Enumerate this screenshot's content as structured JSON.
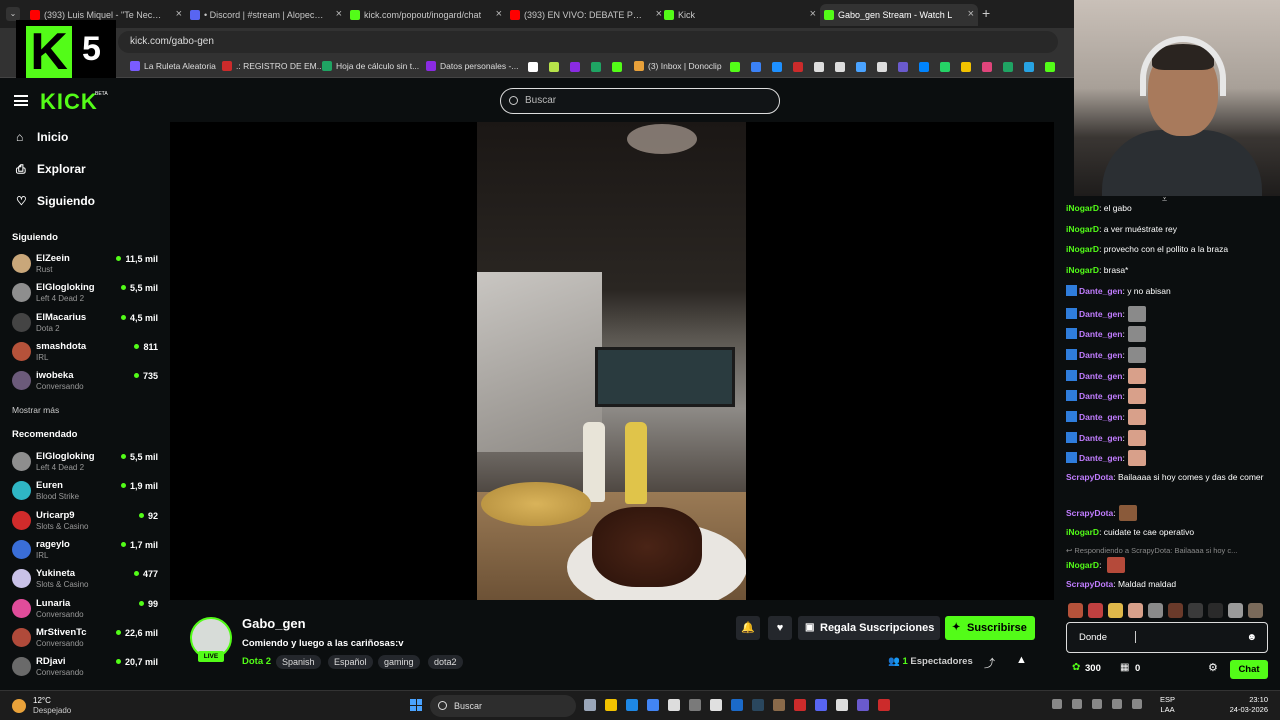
{
  "browser": {
    "tabs": [
      {
        "title": "(393) Luis Miquel - \"Te Necesito\"",
        "color": "#ff0000"
      },
      {
        "title": "• Discord | #stream | Alopecia A",
        "color": "#5865f2"
      },
      {
        "title": "kick.com/popout/inogard/chat",
        "color": "#53fc18"
      },
      {
        "title": "(393) EN VIVO: DEBATE PRESID",
        "color": "#ff0000"
      },
      {
        "title": "Kick",
        "color": "#53fc18"
      },
      {
        "title": "Gabo_gen Stream - Watch L",
        "color": "#53fc18"
      }
    ],
    "new_tab": "+",
    "url": "kick.com/gabo-gen",
    "bookmarks": [
      {
        "label": "La Ruleta Aleatoria",
        "color": "#7a5cff"
      },
      {
        "label": ".: REGISTRO DE EM...",
        "color": "#cc2b2b"
      },
      {
        "label": "Hoja de cálculo sin t...",
        "color": "#1fa463"
      },
      {
        "label": "Datos personales -...",
        "color": "#8a2be2"
      },
      {
        "label": "(3) Inbox | Donoclip",
        "color": "#e8a13a"
      }
    ]
  },
  "overlay_logo": {
    "letter": "K",
    "number": "5"
  },
  "kick": {
    "logo": "KICK",
    "beta": "BETA",
    "search_placeholder": "Buscar",
    "nav": [
      {
        "label": "Inicio",
        "icon": "home-icon",
        "glyph": "⌂"
      },
      {
        "label": "Explorar",
        "icon": "compass-icon",
        "glyph": "⎙"
      },
      {
        "label": "Siguiendo",
        "icon": "heart-icon",
        "glyph": "♡"
      }
    ],
    "following_title": "Siguiendo",
    "following": [
      {
        "name": "ElZeein",
        "category": "Rust",
        "viewers": "11,5 mil",
        "color": "#c9a77a"
      },
      {
        "name": "ElGlogloking",
        "category": "Left 4 Dead 2",
        "viewers": "5,5 mil",
        "color": "#8e8e8e"
      },
      {
        "name": "ElMacarius",
        "category": "Dota 2",
        "viewers": "4,5 mil",
        "color": "#444"
      },
      {
        "name": "smashdota",
        "category": "IRL",
        "viewers": "811",
        "color": "#b5523a"
      },
      {
        "name": "iwobeka",
        "category": "Conversando",
        "viewers": "735",
        "color": "#6b5a7a"
      }
    ],
    "show_more": "Mostrar más",
    "recommended_title": "Recomendado",
    "recommended": [
      {
        "name": "ElGlogloking",
        "category": "Left 4 Dead 2",
        "viewers": "5,5 mil",
        "color": "#8e8e8e"
      },
      {
        "name": "Euren",
        "category": "Blood Strike",
        "viewers": "1,9 mil",
        "color": "#2fb6c4"
      },
      {
        "name": "Uricarp9",
        "category": "Slots & Casino",
        "viewers": "92",
        "color": "#d12b2b"
      },
      {
        "name": "rageylo",
        "category": "IRL",
        "viewers": "1,7 mil",
        "color": "#3a6ed8"
      },
      {
        "name": "Yukineta",
        "category": "Slots & Casino",
        "viewers": "477",
        "color": "#c9c1e8"
      },
      {
        "name": "Lunaria",
        "category": "Conversando",
        "viewers": "99",
        "color": "#e04c9a"
      },
      {
        "name": "MrStivenTc",
        "category": "Conversando",
        "viewers": "22,6 mil",
        "color": "#b04a3a"
      },
      {
        "name": "RDjavi",
        "category": "Conversando",
        "viewers": "20,7 mil",
        "color": "#6a6a6a"
      }
    ]
  },
  "stream": {
    "streamer": "Gabo_gen",
    "live": "LIVE",
    "title": "Comiendo y luego a las cariñosas:v",
    "category": "Dota 2",
    "tags": [
      "Spanish",
      "Español",
      "gaming",
      "dota2"
    ],
    "gift_label": "Regala Suscripciones",
    "subscribe_label": "Suscribirse",
    "viewers_count": "1",
    "viewers_label": "Espectadores"
  },
  "chat": {
    "messages": [
      {
        "user": "iNogarD",
        "color": "#53fc18",
        "text": ": el gabo",
        "badge": false,
        "emote": null
      },
      {
        "user": "iNogarD",
        "color": "#53fc18",
        "text": ": a ver muéstrate rey",
        "badge": false,
        "emote": null
      },
      {
        "user": "iNogarD",
        "color": "#53fc18",
        "text": ": provecho con el pollito a la braza",
        "badge": false,
        "emote": null
      },
      {
        "user": "iNogarD",
        "color": "#53fc18",
        "text": ": brasa*",
        "badge": false,
        "emote": null
      },
      {
        "user": "Dante_gen",
        "color": "#c17dff",
        "text": ": y no abisan",
        "badge": true,
        "emote": null
      },
      {
        "user": "Dante_gen",
        "color": "#c17dff",
        "text": ":",
        "badge": true,
        "emote": "#8a8a8a"
      },
      {
        "user": "Dante_gen",
        "color": "#c17dff",
        "text": ":",
        "badge": true,
        "emote": "#8a8a8a"
      },
      {
        "user": "Dante_gen",
        "color": "#c17dff",
        "text": ":",
        "badge": true,
        "emote": "#8a8a8a"
      },
      {
        "user": "Dante_gen",
        "color": "#c17dff",
        "text": ":",
        "badge": true,
        "emote": "#d8a08a"
      },
      {
        "user": "Dante_gen",
        "color": "#c17dff",
        "text": ":",
        "badge": true,
        "emote": "#d8a08a"
      },
      {
        "user": "Dante_gen",
        "color": "#c17dff",
        "text": ":",
        "badge": true,
        "emote": "#d8a08a"
      },
      {
        "user": "Dante_gen",
        "color": "#c17dff",
        "text": ":",
        "badge": true,
        "emote": "#d8a08a"
      },
      {
        "user": "Dante_gen",
        "color": "#c17dff",
        "text": ":",
        "badge": true,
        "emote": "#d8a08a"
      },
      {
        "user": "ScrapyDota",
        "color": "#c17dff",
        "text": ": Bailaaaa si hoy comes y das de comer",
        "badge": false,
        "emote": null
      },
      {
        "user": "ScrapyDota",
        "color": "#c17dff",
        "text": ":",
        "badge": false,
        "emote": "#8a5a3a"
      },
      {
        "user": "iNogarD",
        "color": "#53fc18",
        "text": ": cuidate te cae operativo",
        "badge": false,
        "emote": null
      }
    ],
    "reply_to": "Respondiendo a ScrapyDota: Bailaaaa si hoy c...",
    "reply_msg": {
      "user": "iNogarD",
      "color": "#53fc18",
      "text": ":",
      "emote": "#b54a3a"
    },
    "last_msg": {
      "user": "ScrapyDota",
      "color": "#c17dff",
      "text": ": Maldad maldad"
    },
    "input_value": "Donde",
    "points": "300",
    "subs_count": "0",
    "chat_button": "Chat"
  },
  "taskbar": {
    "temp": "12°C",
    "weather": "Despejado",
    "search": "Buscar",
    "lang1": "ESP",
    "lang2": "LAA",
    "time": "23:10",
    "date": "24-03-2026"
  }
}
